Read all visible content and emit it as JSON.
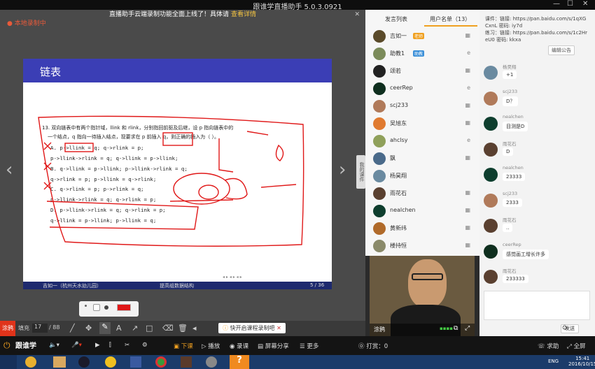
{
  "app": {
    "title": "跟谁学直播助手 5.0.3.0921",
    "minimize": "—",
    "restore": "☐",
    "close": "✕"
  },
  "notice": {
    "text": "直播助手云端录制功能全面上线了！具体请",
    "link": "查看详情",
    "close": "✕"
  },
  "record_status": "本地录制中",
  "slide": {
    "title": "链表",
    "question": "13. 双向链表中有两个指针域，llink 和 rlink，分别指回前驱及后继，设 p 指向链表中的",
    "question2": "一个结点，q 指向一待插入结点，现要求在 p 前插入 q，则正确的插入为（    ）。",
    "options": [
      "A.  p->llink = q;  q->rlink = p;",
      "     p->llink->rlink = q; q->llink = p->llink;",
      "B.  q->llink = p->llink; p->llink->rlink = q;",
      "     q->rlink = p; p->llink = q->rlink;",
      "C.  q->rlink = p; p->rlink = q;",
      "     p->llink->rlink = q; q->rlink = p;",
      "D.  p->llink->rlink = q; q->rlink = p;",
      "     q->llink = p->llink; p->llink = q;"
    ],
    "footer_left": "吉如一（杭州天水幼儿园）",
    "footer_center": "提高组数据结构",
    "page": "5 / 36",
    "nav": "◂ ▸ ◂ ▸ ◂ ▸"
  },
  "side_tab": "我的课件",
  "toolbar": {
    "label_draw": "涂鸦",
    "label_fill": "填充",
    "page_current": "17",
    "page_total": "88",
    "tip": "快开启课程录制吧",
    "tip_close": "✕"
  },
  "tabs": {
    "speakers": "发言列表",
    "users": "用户名单（13）"
  },
  "users": [
    {
      "name": "吉如一",
      "badge": "老师",
      "badge_color": "#f0a020",
      "av": "#5a4a2a",
      "status": "▦"
    },
    {
      "name": "助教1",
      "badge": "助教",
      "badge_color": "#3a8fd8",
      "av": "#7b8b5a",
      "status": "e"
    },
    {
      "name": "颂若",
      "badge": "",
      "badge_color": "",
      "av": "#222",
      "status": "▦"
    },
    {
      "name": "ceerRep",
      "badge": "",
      "badge_color": "",
      "av": "#0e2e1e",
      "status": "e"
    },
    {
      "name": "scj233",
      "badge": "",
      "badge_color": "",
      "av": "#b07a5a",
      "status": "▦"
    },
    {
      "name": "吴旭东",
      "badge": "",
      "badge_color": "",
      "av": "#e07a30",
      "status": "▦"
    },
    {
      "name": "ahclsy",
      "badge": "",
      "badge_color": "",
      "av": "#8fa05a",
      "status": "e"
    },
    {
      "name": "飘",
      "badge": "",
      "badge_color": "",
      "av": "#4a6a8a",
      "status": "▦"
    },
    {
      "name": "杨昊翔",
      "badge": "",
      "badge_color": "",
      "av": "#6a8aa0",
      "status": ""
    },
    {
      "name": "雨花石",
      "badge": "",
      "badge_color": "",
      "av": "#5a4030",
      "status": "▦"
    },
    {
      "name": "nealchen",
      "badge": "",
      "badge_color": "",
      "av": "#0e3e2e",
      "status": "▦"
    },
    {
      "name": "黄新纬",
      "badge": "",
      "badge_color": "",
      "av": "#b06a2a",
      "status": "▦"
    },
    {
      "name": "楼持恒",
      "badge": "",
      "badge_color": "",
      "av": "#8a8a6a",
      "status": "▦"
    }
  ],
  "video": {
    "label": "涂鸦",
    "signal": "▪▪▪▪"
  },
  "announcement": {
    "line1": "课件：链接: https://pan.baidu.com/s/1qXG",
    "line2": "CxnL 密码: iy7d",
    "line3": "练习：链接: https://pan.baidu.com/s/1c2Hr",
    "line4": "eU0 密码: kkxa",
    "edit": "编辑公告"
  },
  "messages": [
    {
      "name": "杨昊翔",
      "text": "+1",
      "av": "#6a8aa0"
    },
    {
      "name": "scj233",
      "text": "D？",
      "av": "#b07a5a"
    },
    {
      "name": "nealchen",
      "text": "目测是D",
      "av": "#0e3e2e"
    },
    {
      "name": "雨花石",
      "text": "D",
      "av": "#5a4030"
    },
    {
      "name": "nealchen",
      "text": "23333",
      "av": "#0e3e2e"
    },
    {
      "name": "scj233",
      "text": "2333",
      "av": "#b07a5a"
    },
    {
      "name": "雨花石",
      "text": "..",
      "av": "#5a4030"
    },
    {
      "name": "ceerRep",
      "text": "感觉画工增长许多",
      "av": "#0e2e1e"
    },
    {
      "name": "雨花石",
      "text": "233333",
      "av": "#5a4030"
    }
  ],
  "chat": {
    "send": "发送",
    "emoji": "☺"
  },
  "bottombar": {
    "logo": "跟谁学",
    "class_end": "下课",
    "play": "播放",
    "record": "录课",
    "share": "屏幕分享",
    "more": "更多",
    "reward": "打赏：0",
    "help": "求助",
    "fullscreen": "全屏"
  },
  "taskbar": {
    "lang": "ENG",
    "time": "15:41",
    "date": "2016/10/15"
  }
}
